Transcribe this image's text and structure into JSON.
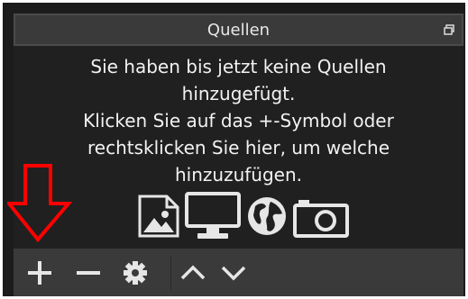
{
  "dock": {
    "title": "Quellen",
    "empty_message_lines": [
      "Sie haben bis jetzt keine Quellen",
      "hinzugefügt.",
      "Klicken Sie auf das +-Symbol oder",
      "rechtsklicken Sie hier, um welche",
      "hinzuzufügen."
    ],
    "source_type_icons": [
      "image-icon",
      "monitor-icon",
      "globe-icon",
      "camera-icon"
    ],
    "toolbar_icons": [
      "plus-icon",
      "minus-icon",
      "gear-icon",
      "chevron-up-icon",
      "chevron-down-icon"
    ]
  },
  "annotation": {
    "icon": "red-down-arrow-icon",
    "color": "#ff0000"
  },
  "colors": {
    "panel_bg": "#202020",
    "titlebar_bg": "#3a3a3a",
    "toolbar_bg": "#3a3a3a",
    "text": "#f2f2f2",
    "icon": "#e6e6e6"
  }
}
